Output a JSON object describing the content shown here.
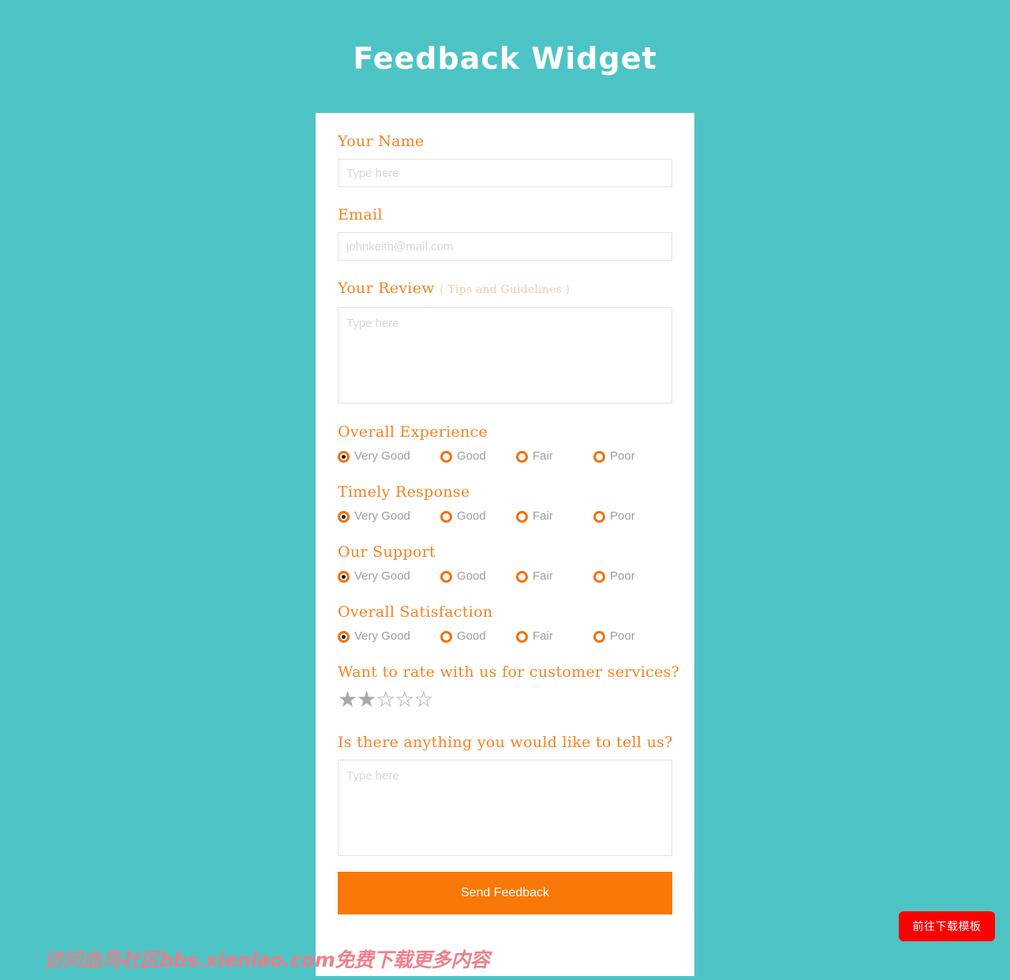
{
  "page": {
    "title": "Feedback Widget",
    "background_color": "#4cc4c5",
    "accent_color": "#f5821f"
  },
  "form": {
    "name_field": {
      "label": "Your Name",
      "placeholder": "Type here",
      "value": ""
    },
    "email_field": {
      "label": "Email",
      "placeholder": "johnkeith@mail.com",
      "value": ""
    },
    "review_field": {
      "label": "Your Review",
      "label_note": "( Tips and Guidelines )",
      "placeholder": "Type here",
      "value": ""
    },
    "rating_groups": [
      {
        "label": "Overall Experience",
        "options": [
          "Very Good",
          "Good",
          "Fair",
          "Poor"
        ],
        "selected": "Very Good"
      },
      {
        "label": "Timely Response",
        "options": [
          "Very Good",
          "Good",
          "Fair",
          "Poor"
        ],
        "selected": "Very Good"
      },
      {
        "label": "Our Support",
        "options": [
          "Very Good",
          "Good",
          "Fair",
          "Poor"
        ],
        "selected": "Very Good"
      },
      {
        "label": "Overall Satisfaction",
        "options": [
          "Very Good",
          "Good",
          "Fair",
          "Poor"
        ],
        "selected": "Very Good"
      }
    ],
    "star_rating": {
      "label": "Want to rate with us for customer services?",
      "value": 2,
      "max": 5,
      "filled_glyph": "★",
      "empty_glyph": "☆",
      "color": "#a8a8a8"
    },
    "extra_field": {
      "label": "Is there anything you would like to tell us?",
      "placeholder": "Type here",
      "value": ""
    },
    "submit": {
      "label": "Send Feedback",
      "color": "#f97807"
    }
  },
  "overlays": {
    "watermark": "访问血鸟社区bbs.xienlao.com免费下载更多内容",
    "download_button": {
      "label": "前往下载模板",
      "color": "#fc0000"
    }
  }
}
